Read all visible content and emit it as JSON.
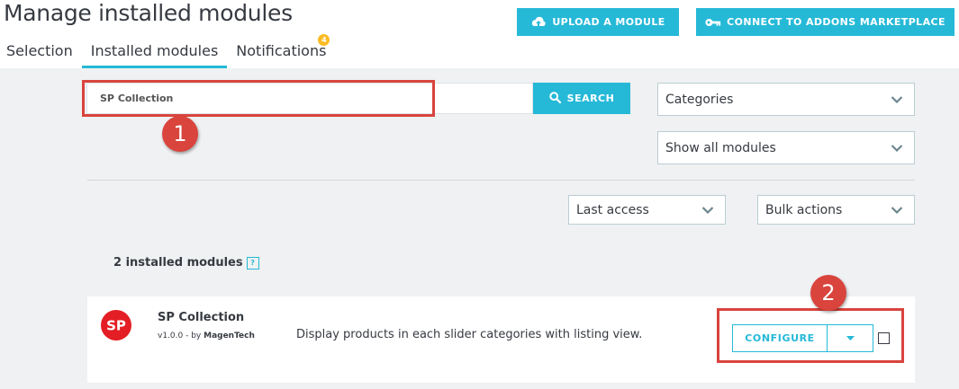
{
  "header": {
    "title": "Manage installed modules",
    "upload_label": "UPLOAD A MODULE",
    "connect_label": "CONNECT TO ADDONS MARKETPLACE"
  },
  "tabs": [
    {
      "label": "Selection",
      "active": false
    },
    {
      "label": "Installed modules",
      "active": true
    },
    {
      "label": "Notifications",
      "active": false,
      "badge": "4"
    }
  ],
  "search": {
    "value": "SP Collection",
    "button_label": "SEARCH"
  },
  "filters": {
    "categories": "Categories",
    "show": "Show all modules",
    "sort": "Last access",
    "bulk": "Bulk actions"
  },
  "summary": {
    "count_label": "2 installed modules",
    "help": "?"
  },
  "module": {
    "logo_text": "SP",
    "name": "SP Collection",
    "version_text": "v1.0.0 - by",
    "author": "MagenTech",
    "description": "Display products in each slider categories with listing view.",
    "configure_label": "CONFIGURE"
  },
  "annotations": [
    {
      "number": "1"
    },
    {
      "number": "2"
    }
  ],
  "colors": {
    "accent": "#25b9d7",
    "annotation": "#d9443d",
    "badge": "#fbbb22",
    "logo": "#e31e24"
  }
}
